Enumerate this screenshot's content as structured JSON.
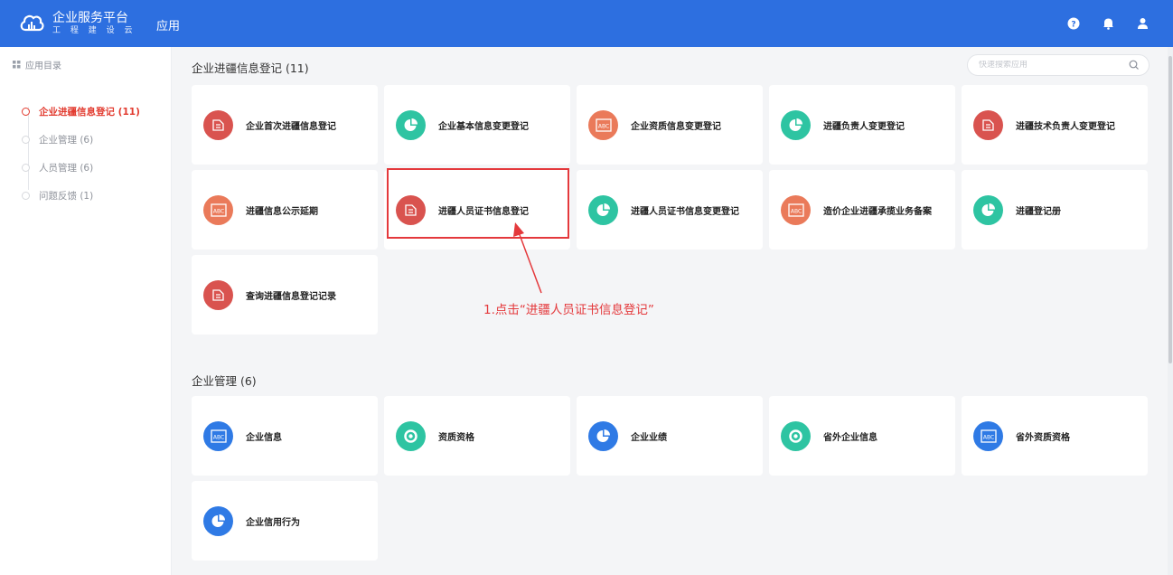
{
  "header": {
    "brand_title": "企业服务平台",
    "brand_subtitle": "工 程 建 设 云",
    "nav_app": "应用",
    "icons": [
      "help-icon",
      "bell-icon",
      "user-icon"
    ],
    "color": "#2d6fe0"
  },
  "sidebar": {
    "title": "应用目录",
    "items": [
      {
        "label": "企业进疆信息登记 (11)",
        "active": true
      },
      {
        "label": "企业管理 (6)",
        "active": false
      },
      {
        "label": "人员管理 (6)",
        "active": false
      },
      {
        "label": "问题反馈 (1)",
        "active": false
      }
    ]
  },
  "search": {
    "placeholder": "快速搜索应用"
  },
  "sections": [
    {
      "title": "企业进疆信息登记 (11)",
      "cards": [
        {
          "label": "企业首次进疆信息登记",
          "icon": "document-icon",
          "color": "#d9534f"
        },
        {
          "label": "企业基本信息变更登记",
          "icon": "pie-chart-icon",
          "color": "#2ec4a2"
        },
        {
          "label": "企业资质信息变更登记",
          "icon": "abc-card-icon",
          "color": "#ea7a5a"
        },
        {
          "label": "进疆负责人变更登记",
          "icon": "pie-chart-icon",
          "color": "#2ec4a2"
        },
        {
          "label": "进疆技术负责人变更登记",
          "icon": "document-icon",
          "color": "#d9534f"
        },
        {
          "label": "进疆信息公示延期",
          "icon": "abc-card-icon",
          "color": "#ea7a5a"
        },
        {
          "label": "进疆人员证书信息登记",
          "icon": "document-icon",
          "color": "#d9534f"
        },
        {
          "label": "进疆人员证书信息变更登记",
          "icon": "pie-chart-icon",
          "color": "#2ec4a2"
        },
        {
          "label": "造价企业进疆承揽业务备案",
          "icon": "abc-card-icon",
          "color": "#ea7a5a"
        },
        {
          "label": "进疆登记册",
          "icon": "pie-chart-icon",
          "color": "#2ec4a2"
        },
        {
          "label": "查询进疆信息登记记录",
          "icon": "document-icon",
          "color": "#d9534f"
        }
      ]
    },
    {
      "title": "企业管理 (6)",
      "cards": [
        {
          "label": "企业信息",
          "icon": "abc-card-icon",
          "color": "#2f7ae5"
        },
        {
          "label": "资质资格",
          "icon": "ring-icon",
          "color": "#2ec4a2"
        },
        {
          "label": "企业业绩",
          "icon": "pie-chart-icon",
          "color": "#2f7ae5"
        },
        {
          "label": "省外企业信息",
          "icon": "ring-icon",
          "color": "#2ec4a2"
        },
        {
          "label": "省外资质资格",
          "icon": "abc-card-icon",
          "color": "#2f7ae5"
        },
        {
          "label": "企业信用行为",
          "icon": "pie-chart-icon",
          "color": "#2f7ae5"
        }
      ]
    }
  ],
  "annotation": {
    "text": "1.点击“进疆人员证书信息登记”",
    "color": "#e4393c"
  }
}
